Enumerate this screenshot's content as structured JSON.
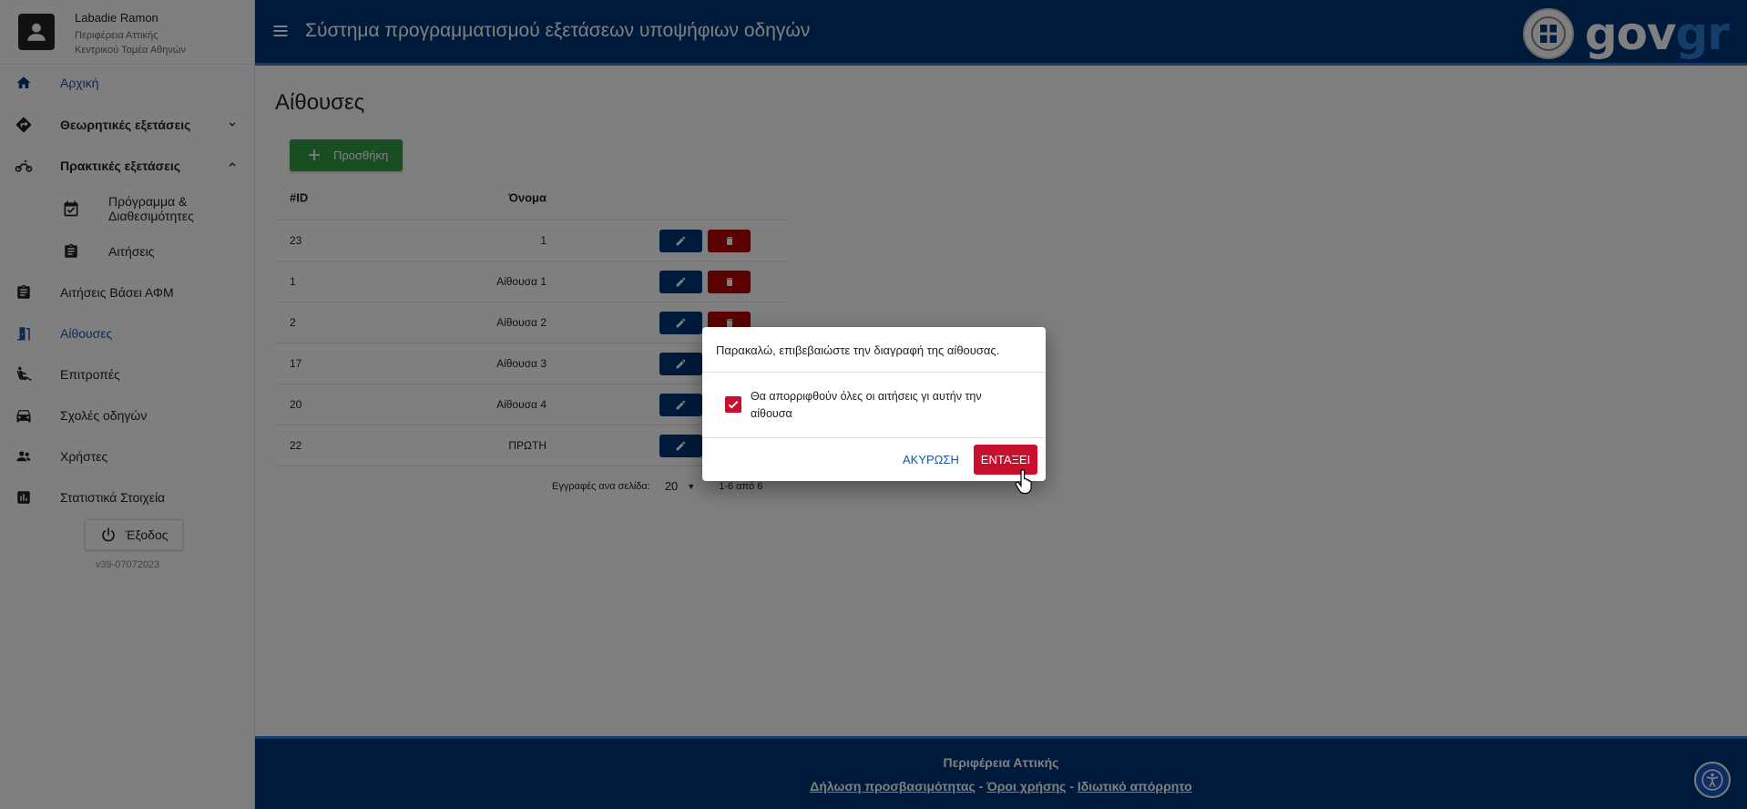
{
  "user": {
    "name": "Labadie Ramon",
    "region": "Περιφέρεια Αττικής",
    "sector": "Κεντρικού Τομέα Αθηνών"
  },
  "nav": {
    "home": "Αρχική",
    "theory": "Θεωρητικές εξετάσεις",
    "practical": "Πρακτικές εξετάσεις",
    "schedule": "Πρόγραμμα & Διαθεσιμότητες",
    "applications": "Αιτήσεις",
    "afm_applications": "Αιτήσεις Βάσει ΑΦΜ",
    "rooms": "Αίθουσες",
    "committees": "Επιτροπές",
    "schools": "Σχολές οδηγών",
    "users": "Χρήστες",
    "stats": "Στατιστικά Στοιχεία"
  },
  "logout_label": "Έξοδος",
  "version": "v39-07072023",
  "header": {
    "title": "Σύστημα προγραμματισμού εξετάσεων υποψήφιων οδηγών",
    "logo_gov": "gov",
    "logo_gr": "gr"
  },
  "page": {
    "title": "Αίθουσες",
    "add_label": "Προσθήκη"
  },
  "table": {
    "headers": {
      "id": "#ID",
      "name": "Όνομα"
    },
    "rows": [
      {
        "id": "23",
        "name": "1"
      },
      {
        "id": "1",
        "name": "Αίθουσα 1"
      },
      {
        "id": "2",
        "name": "Αίθουσα 2"
      },
      {
        "id": "17",
        "name": "Αίθουσα 3"
      },
      {
        "id": "20",
        "name": "Αίθουσα 4"
      },
      {
        "id": "22",
        "name": "ΠΡΩΤΗ"
      }
    ]
  },
  "pager": {
    "rows_per_page_label": "Εγγραφές ανα σελίδα:",
    "rows_per_page": "20",
    "range": "1-6 από 6"
  },
  "footer": {
    "region": "Περιφέρεια Αττικής",
    "accessibility": "Δήλωση προσβασιμότητας",
    "sep": " - ",
    "terms": "Όροι χρήσης",
    "privacy": "Ιδιωτικό απόρρητο"
  },
  "dialog": {
    "message": "Παρακαλώ, επιβεβαιώστε την διαγραφή της αίθουσας.",
    "checkbox_label": "Θα απορριφθούν όλες οι αιτήσεις γι αυτήν την αίθουσα",
    "checkbox_checked": true,
    "cancel": "ΑΚΥΡΩΣΗ",
    "confirm": "ΕΝΤΑΞΕΙ"
  },
  "colors": {
    "primary": "#003476",
    "accent": "#2a7bd5",
    "add": "#2e9e44",
    "delete": "#b60202",
    "confirm": "#c8102e"
  }
}
